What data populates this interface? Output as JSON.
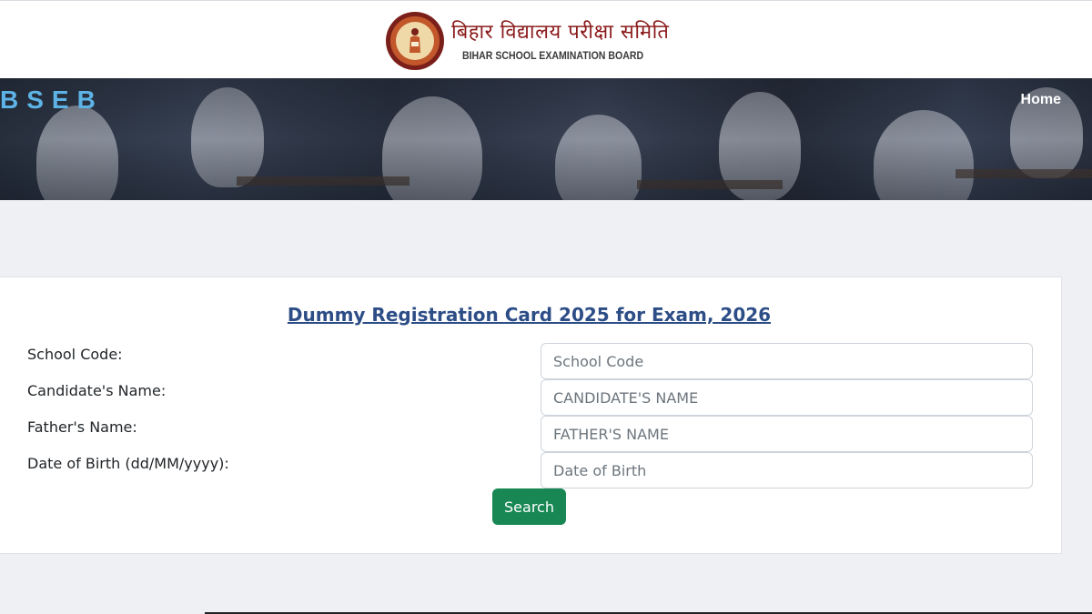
{
  "header": {
    "hindi_title": "बिहार विद्यालय परीक्षा समिति",
    "english_title": "BIHAR SCHOOL EXAMINATION BOARD",
    "logo_icon": "bseb-emblem-icon"
  },
  "navbar": {
    "brand": "BSEB",
    "home_label": "Home",
    "brand_color": "#5eb3e6"
  },
  "form": {
    "title": "Dummy Registration Card 2025 for Exam, 2026",
    "fields": [
      {
        "label": "School Code:",
        "placeholder": "School Code",
        "value": ""
      },
      {
        "label": "Candidate's Name:",
        "placeholder": "CANDIDATE'S NAME",
        "value": ""
      },
      {
        "label": "Father's Name:",
        "placeholder": "FATHER'S NAME",
        "value": ""
      },
      {
        "label": "Date of Birth (dd/MM/yyyy):",
        "placeholder": "Date of Birth",
        "value": ""
      }
    ],
    "search_label": "Search",
    "search_color": "#198754",
    "title_color": "#2d4d86"
  }
}
